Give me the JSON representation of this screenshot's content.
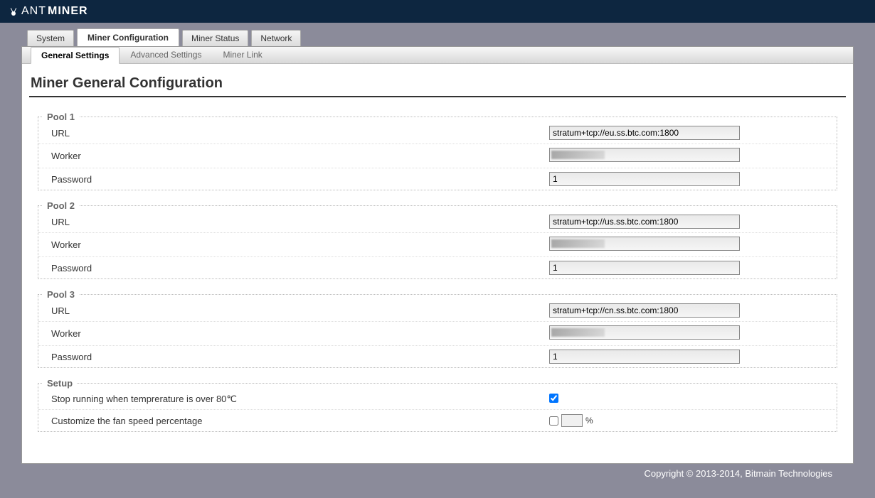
{
  "brand": {
    "ant": "ANT",
    "miner": "MINER"
  },
  "tabs_primary": [
    {
      "label": "System",
      "active": false
    },
    {
      "label": "Miner Configuration",
      "active": true
    },
    {
      "label": "Miner Status",
      "active": false
    },
    {
      "label": "Network",
      "active": false
    }
  ],
  "tabs_secondary": [
    {
      "label": "General Settings",
      "active": true
    },
    {
      "label": "Advanced Settings",
      "active": false
    },
    {
      "label": "Miner Link",
      "active": false
    }
  ],
  "page_title": "Miner General Configuration",
  "pools": [
    {
      "legend": "Pool 1",
      "url_label": "URL",
      "url_value": "stratum+tcp://eu.ss.btc.com:1800",
      "worker_label": "Worker",
      "worker_value": "",
      "password_label": "Password",
      "password_value": "1"
    },
    {
      "legend": "Pool 2",
      "url_label": "URL",
      "url_value": "stratum+tcp://us.ss.btc.com:1800",
      "worker_label": "Worker",
      "worker_value": "",
      "password_label": "Password",
      "password_value": "1"
    },
    {
      "legend": "Pool 3",
      "url_label": "URL",
      "url_value": "stratum+tcp://cn.ss.btc.com:1800",
      "worker_label": "Worker",
      "worker_value": "",
      "password_label": "Password",
      "password_value": "1"
    }
  ],
  "setup": {
    "legend": "Setup",
    "stop_temp_label": "Stop running when temprerature is over 80℃",
    "stop_temp_checked": true,
    "fan_label": "Customize the fan speed percentage",
    "fan_checked": false,
    "fan_value": "",
    "fan_suffix": "%"
  },
  "footer": "Copyright © 2013-2014, Bitmain Technologies"
}
